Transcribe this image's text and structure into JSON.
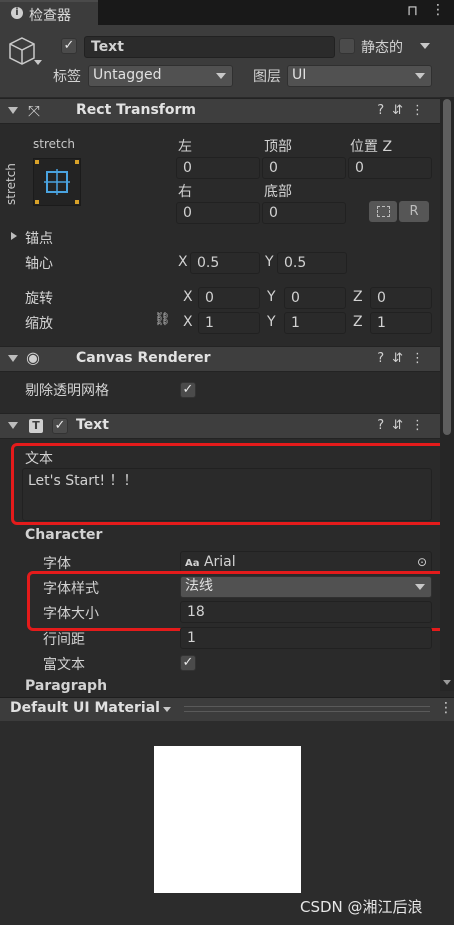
{
  "tab": {
    "label": "检查器"
  },
  "object": {
    "name": "Text",
    "static_label": "静态的",
    "tag_label": "标签",
    "tag_value": "Untagged",
    "layer_label": "图层",
    "layer_value": "UI"
  },
  "rect_transform": {
    "title": "Rect Transform",
    "anchor_preset_h": "stretch",
    "anchor_preset_v": "stretch",
    "left_label": "左",
    "top_label": "顶部",
    "posz_label": "位置 Z",
    "left_value": "0",
    "top_value": "0",
    "posz_value": "0",
    "right_label": "右",
    "bottom_label": "底部",
    "right_value": "0",
    "bottom_value": "0",
    "r_button": "R",
    "anchors_label": "锚点",
    "pivot_label": "轴心",
    "pivot_x": "0.5",
    "pivot_y": "0.5",
    "rotation_label": "旋转",
    "rot_x": "0",
    "rot_y": "0",
    "rot_z": "0",
    "scale_label": "缩放",
    "scale_x": "1",
    "scale_y": "1",
    "scale_z": "1",
    "x": "X",
    "y": "Y",
    "z": "Z"
  },
  "canvas_renderer": {
    "title": "Canvas Renderer",
    "cull_label": "剔除透明网格"
  },
  "text_component": {
    "title": "Text",
    "text_label": "文本",
    "text_value": "Let's Start! ！！",
    "character_header": "Character",
    "font_label": "字体",
    "font_value": "Arial",
    "font_style_label": "字体样式",
    "font_style_value": "法线",
    "font_size_label": "字体大小",
    "font_size_value": "18",
    "line_spacing_label": "行间距",
    "line_spacing_value": "1",
    "rich_text_label": "富文本",
    "paragraph_header": "Paragraph"
  },
  "material": {
    "title": "Default UI Material"
  },
  "watermark": "CSDN @湘江后浪",
  "colors": {
    "highlight": "#e41b1b",
    "anchor_blue": "#4aa3df"
  }
}
